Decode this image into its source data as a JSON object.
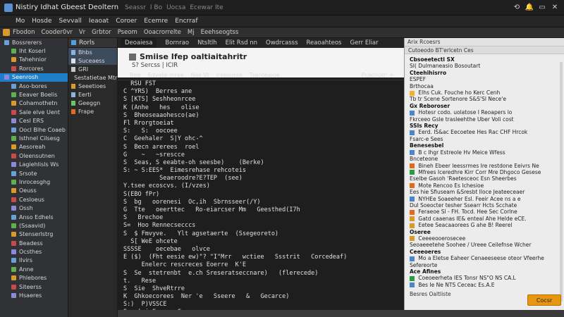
{
  "titlebar": {
    "title": "Nistiry Idhat Gbeest Deoltern",
    "items": [
      "Seassr",
      "I  Bo",
      "Uocsa",
      "Ecewar Ite"
    ],
    "controls": [
      "⟲",
      "🔔",
      "▭",
      "✕"
    ]
  },
  "menubar": {
    "items": [
      "Mo",
      "Hosde",
      "Sevvall",
      "Ieaoat",
      "Coroer",
      "Ecemre",
      "Encrraf"
    ]
  },
  "toolbar": {
    "items": [
      "Fbodon",
      "Cooder0vr",
      "Vr",
      "Grbtor",
      "Pseom",
      "Ooacrorrelte",
      "Mj",
      "Eeehseogtss"
    ]
  },
  "leftpanel": {
    "items": [
      {
        "label": "Bossrerers",
        "sel": false,
        "indent": false
      },
      {
        "label": "Iht Koserl",
        "sel": false,
        "indent": true
      },
      {
        "label": "Tahehnior",
        "sel": false,
        "indent": true
      },
      {
        "label": "Rorcores",
        "sel": false,
        "indent": true
      },
      {
        "label": "Seenrosh",
        "sel": true,
        "indent": false
      },
      {
        "label": "Aso-bores",
        "sel": false,
        "indent": true
      },
      {
        "label": "Eeaver Boelis",
        "sel": false,
        "indent": true
      },
      {
        "label": "Cohamothetn",
        "sel": false,
        "indent": true
      },
      {
        "label": "Sale elve Uent",
        "sel": false,
        "indent": true
      },
      {
        "label": "Cesl ERS",
        "sel": false,
        "indent": true
      },
      {
        "label": "Oocl Blhe Coaeb",
        "sel": false,
        "indent": true
      },
      {
        "label": "Isthnel Cilsesg",
        "sel": false,
        "indent": true
      },
      {
        "label": "Aesoreah",
        "sel": false,
        "indent": true
      },
      {
        "label": "Oleensutnen",
        "sel": false,
        "indent": true
      },
      {
        "label": "Lagiehlisls Ws",
        "sel": false,
        "indent": true
      },
      {
        "label": "Srsote",
        "sel": false,
        "indent": true
      },
      {
        "label": "Inrocesghg",
        "sel": false,
        "indent": true
      },
      {
        "label": "Oeuss",
        "sel": false,
        "indent": true
      },
      {
        "label": "Cesloeus",
        "sel": false,
        "indent": true
      },
      {
        "label": "Ossh",
        "sel": false,
        "indent": true
      },
      {
        "label": "Anso Edhels",
        "sel": false,
        "indent": true
      },
      {
        "label": "(Ssaavid)",
        "sel": false,
        "indent": true
      },
      {
        "label": "Stenserlstrg",
        "sel": false,
        "indent": true
      },
      {
        "label": "Beadess",
        "sel": false,
        "indent": true
      },
      {
        "label": "Ocsthes",
        "sel": false,
        "indent": true
      },
      {
        "label": "Ilvirs",
        "sel": false,
        "indent": true
      },
      {
        "label": "Anne",
        "sel": false,
        "indent": true
      },
      {
        "label": "Phlebores",
        "sel": false,
        "indent": true
      },
      {
        "label": "Siteerss",
        "sel": false,
        "indent": true
      },
      {
        "label": "Hsaeres",
        "sel": false,
        "indent": true
      }
    ]
  },
  "sidetree": {
    "head": "Rorls",
    "items": [
      {
        "label": "Bhbs",
        "hl": true
      },
      {
        "label": "Suceaess",
        "hl": true
      },
      {
        "label": "GRI",
        "hl": false
      },
      {
        "label": "Sestatietae Mtr",
        "hl": false
      },
      {
        "label": "Seeetioes",
        "hl": false
      },
      {
        "label": "Eerti",
        "hl": false
      },
      {
        "label": "Geeggn",
        "hl": false
      },
      {
        "label": "Frape",
        "hl": false
      }
    ]
  },
  "editor": {
    "tabs": [
      "Deoaiesa",
      "Bornrao",
      "Ntsltlh",
      "Elit Rsd nn",
      "Owdrcasss",
      "Reaoahteos",
      "Gerr Eliar"
    ],
    "doc_title": "Smiise Ifep oaltiaitahritr",
    "doc_subtitle": "S?  Sercss | ICIR",
    "doc_tabs": [
      "Tree",
      "Edvete Inree",
      "Nes Vt",
      "Irsesusse",
      "Tsentealoe"
    ],
    "doc_tab_right": "Pcachotr' +",
    "lines": [
      "  RSU FST",
      "C ^YRS)  Berres ane",
      "S [KTS] Seshheonrcee",
      "K (Anhe   hes   olise",
      "S  Bheoseaaohesco(ae)",
      "Fl Rrorgtoeiat",
      "S:   S:  oocoee",
      "C  Geehaler  S|Y ohc-^",
      "S  Becn arerees  roel",
      "G    ~   ~srescce",
      "S  Seas, S eeabte-oh seesbe)    (Berke)",
      "S: ~ S:EES*  Eimesrehase rehcoteis",
      "          Seaeroodre?E?TEP  (see)",
      "Y.tsee ecoscvs. (I/vzes)",
      "S(EBO fPr)",
      "S  bg   oorenesi  Oc,ih  Sbrnsseer(/Y)",
      "G  Tte   oeerttec   Ro-eiarcser Mm   Geesthed(I7h",
      "S   Brechoe",
      "S=  Hoo Rennecsecccs",
      "S  $ Fmvyve.   Ylt agsetaerte  (Ssegeoreto)",
      "  S[ WeE ohcete",
      "SSSSE    oecebae   olvce",
      "E ($)  (Fht eesie ew)\"? \"I\"Mrr   wctiee   Ssstrit   Corcedeaf)",
      "     Enelerc rescreces Eoerre  K'E",
      "S  Se  stetrenbt  e.ch Sreseratseccnare)   (flerecede)",
      "t.   Rese",
      "S  Sie  ShveRtrre",
      "K  Ghkoecorees  Ner 'e   Sseere   &   Gecarce)",
      "S:)  P)VSSCE",
      "S   ) ieSnasea Gs",
      "K ty s   a   Merceer (/?  SHCF Emetereecce"
    ]
  },
  "rightpanel": {
    "top": "Arix Rcoesrs",
    "bar": "Cutoeodo BT'erlcetn Ces",
    "lines": [
      {
        "t": "Cbsoeetectl SX",
        "head": true,
        "ico": ""
      },
      {
        "t": "  SI(       Dulmaneasio  Bosoutart",
        "head": false,
        "ico": ""
      },
      {
        "t": "  Cteehihisrro",
        "head": true,
        "ico": ""
      },
      {
        "t": "  ESPEF",
        "head": false,
        "ico": ""
      },
      {
        "t": "  Brthocaa",
        "head": false,
        "ico": ""
      },
      {
        "t": "  Elhs     Cuk.    Fouche  ho  Kerc Cenh",
        "head": false,
        "ico": "#f0b030"
      },
      {
        "t": "  Tb  tr  Scene   Sortenore  S&S'Sl Nece'e",
        "head": false,
        "ico": ""
      },
      {
        "t": "Gx  Reboroser",
        "head": true,
        "ico": ""
      },
      {
        "t": "  Hotesr   codo.   uolatose    I    Reoapers   lo",
        "head": false,
        "ico": "#4a86c8"
      },
      {
        "t": "  Fkrceeo  Gsle   trasleehthe  Uber  Voli   cost",
        "head": false,
        "ico": ""
      },
      {
        "t": "SSIs  Recy",
        "head": true,
        "ico": ""
      },
      {
        "t": "  Eerd.   IS&ac  Eecoetee Hes Rac  CHF  Hrcok",
        "head": false,
        "ico": "#4a86c8"
      },
      {
        "t": "  Fsarc-e  Sees",
        "head": false,
        "ico": ""
      },
      {
        "t": "Benesesbel",
        "head": true,
        "ico": ""
      },
      {
        "t": "  B    c   Ihgr   Estreole  Hv   Meice  Wfess",
        "head": false,
        "ico": "#4a86c8"
      },
      {
        "t": "  Bnceteone",
        "head": false,
        "ico": ""
      },
      {
        "t": "  Bineh   Ebeer  leessrmes   Ire  restdone   Eeivrs   Ne",
        "head": false,
        "ico": "#e06a20"
      },
      {
        "t": "  Mfrees  Iceredhre Kirr Corr Mre  Dhgoco  Gesese",
        "head": false,
        "ico": "#2e9a3e"
      },
      {
        "t": "  Eselbe  Gasoh 'Raetesceoc    Esn  Sheerbes",
        "head": false,
        "ico": ""
      },
      {
        "t": "  Mote   Rencoo   Es Ichesioe",
        "head": false,
        "ico": "#e06a20"
      },
      {
        "t": "  Ees   hie  Sfiuseam &Sresbt   Iloce  Jeateeceaer",
        "head": false,
        "ico": ""
      },
      {
        "t": "",
        "head": false,
        "ico": ""
      },
      {
        "t": "  NYHEe  Soaeeher  Esl.     Feeir   Acee  ns  a e",
        "head": false,
        "ico": "#4a86c8"
      },
      {
        "t": "  Dul Soeocter  tesher  Ssearr  Hcts  Scchate",
        "head": false,
        "ico": ""
      },
      {
        "t": "  Feraeoe  Sl  - FH.    Tocd.    Hee  Sec  Corlne",
        "head": false,
        "ico": "#e06a20"
      },
      {
        "t": "  Gatd  caaenas   IE&  enteal   Ahe   Helde   eCE.",
        "head": false,
        "ico": "#d89a2a"
      },
      {
        "t": "  Eetee   Seacaaorees   G   ahe   B!   Reerel",
        "head": false,
        "ico": "#d89a2a"
      },
      {
        "t": "  Oseree",
        "head": true,
        "ico": ""
      },
      {
        "t": "  Ceeeeooerosecee",
        "head": false,
        "ico": "#d89a2a"
      },
      {
        "t": "  Seoaeeetehe Soohee  /  Ureee  Ceilefnse  Wcher",
        "head": false,
        "ico": ""
      },
      {
        "t": "  Ceeeoeres",
        "head": true,
        "ico": ""
      },
      {
        "t": "  Mo  a  Eletse  Eaheer  Cenaeeseese  oteor  Vfeerhe",
        "head": false,
        "ico": "#4a86c8"
      },
      {
        "t": "  Sefereorte",
        "head": false,
        "ico": ""
      },
      {
        "t": "  Ace  Afines",
        "head": true,
        "ico": ""
      },
      {
        "t": "  Coeoeerheta    IES  Tonsr  NS\"O  NS  CA.L",
        "head": false,
        "ico": "#2e9a3e"
      },
      {
        "t": "  Bes  Ie  Ne    NTS  Ceceac  Es.A.E",
        "head": false,
        "ico": "#4a86c8"
      }
    ],
    "footer": "Besres  Oaltliste",
    "button": "Cocsr"
  }
}
